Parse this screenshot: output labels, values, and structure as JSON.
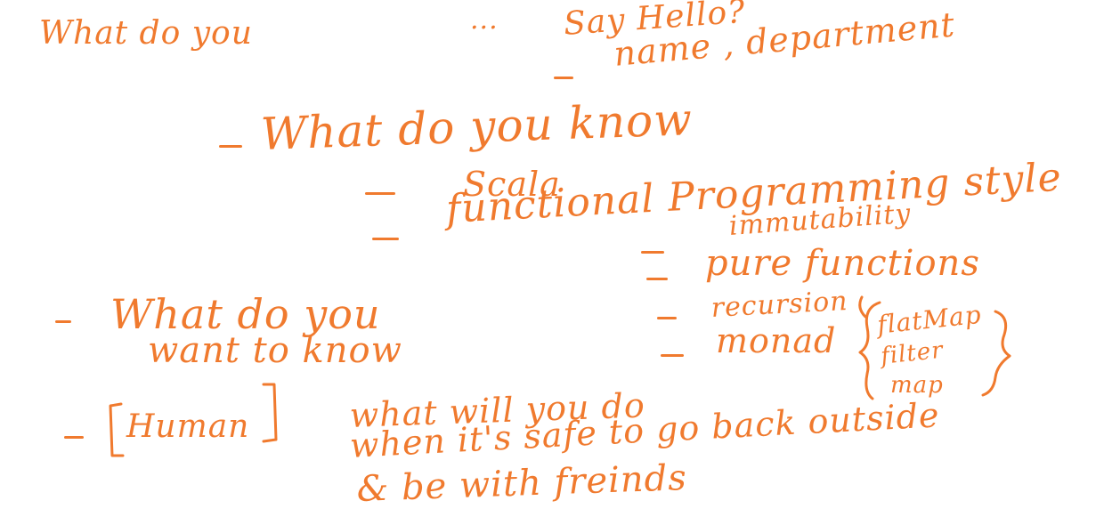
{
  "ink_color": "#f07a2e",
  "notes": {
    "what_do_you": "What do you",
    "ellipsis": "...",
    "say_hello": "Say Hello?",
    "name_department": "name , department",
    "what_do_you_know": "What do you know",
    "scala": "Scala",
    "functional_programming_style": "functional Programming style",
    "immutability": "immutability",
    "pure_functions": "pure functions",
    "recursion": "recursion",
    "monad": "monad",
    "flatmap": "flatMap",
    "filter": "filter",
    "map": "map",
    "what_do_you_2": "What do you",
    "want_to_know": "want to know",
    "human": "Human",
    "what_will_you_do": "what will you do",
    "when_safe": "when it's safe to go back outside",
    "be_with_friends": "& be with freinds"
  }
}
